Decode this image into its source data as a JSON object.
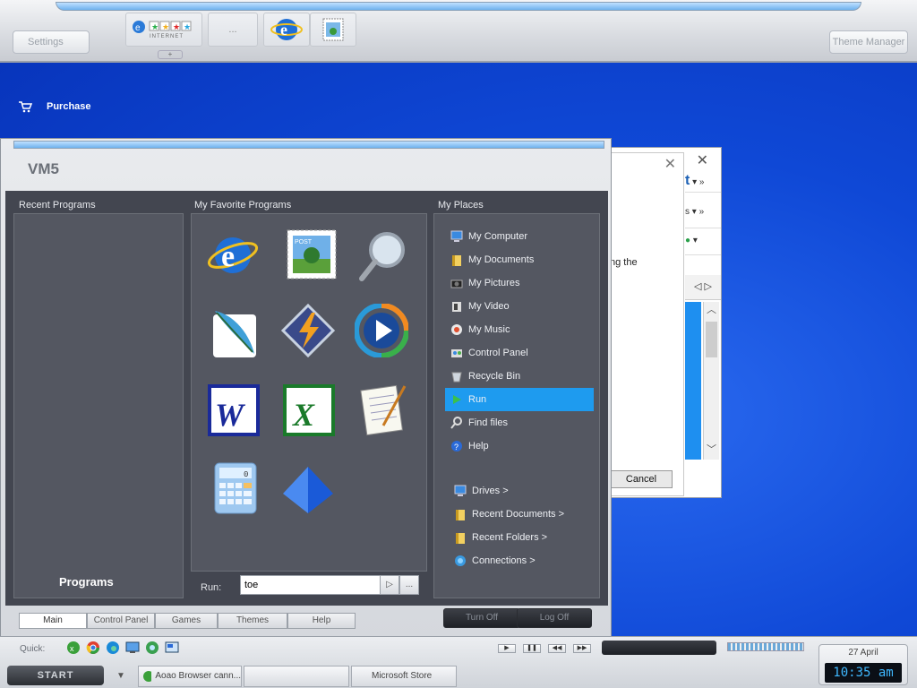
{
  "topbar": {
    "settings_label": "Settings",
    "theme_manager_label": "Theme Manager",
    "more_label": "...",
    "internet_label": "INTERNET",
    "expand_label": "+"
  },
  "desktop": {
    "purchase_label": "Purchase"
  },
  "background_window": {
    "text_fragment": "ng the",
    "cancel_label": "Cancel",
    "letter_s": "s"
  },
  "start_menu": {
    "title": "VM5",
    "recent_programs_head": "Recent Programs",
    "favorites_head": "My Favorite Programs",
    "places_head": "My Places",
    "programs_label": "Programs",
    "favorites": [
      {
        "icon": "internet-explorer-icon"
      },
      {
        "icon": "mail-stamp-icon"
      },
      {
        "icon": "magnifier-icon"
      },
      {
        "icon": "feather-icon"
      },
      {
        "icon": "winamp-icon"
      },
      {
        "icon": "media-player-icon"
      },
      {
        "icon": "word-icon"
      },
      {
        "icon": "excel-icon"
      },
      {
        "icon": "notepad-icon"
      },
      {
        "icon": "calculator-icon"
      },
      {
        "icon": "pyramid-icon"
      }
    ],
    "places": [
      {
        "label": "My Computer",
        "icon": "computer-icon"
      },
      {
        "label": "My Documents",
        "icon": "folder-icon"
      },
      {
        "label": "My Pictures",
        "icon": "camera-icon"
      },
      {
        "label": "My Video",
        "icon": "video-icon"
      },
      {
        "label": "My Music",
        "icon": "music-icon"
      },
      {
        "label": "Control Panel",
        "icon": "control-panel-icon"
      },
      {
        "label": "Recycle Bin",
        "icon": "recycle-bin-icon"
      },
      {
        "label": "Run",
        "icon": "run-icon"
      },
      {
        "label": "Find files",
        "icon": "search-icon"
      },
      {
        "label": "Help",
        "icon": "help-icon"
      }
    ],
    "submenus": [
      {
        "label": "Drives >",
        "icon": "drive-icon"
      },
      {
        "label": "Recent Documents >",
        "icon": "folder-icon"
      },
      {
        "label": "Recent Folders >",
        "icon": "folder-icon"
      },
      {
        "label": "Connections >",
        "icon": "network-icon"
      }
    ],
    "run_label": "Run:",
    "run_value": "toe",
    "run_go": "▷",
    "run_browse": "...",
    "tabs": [
      "Main",
      "Control Panel",
      "Games",
      "Themes",
      "Help"
    ],
    "turn_off_label": "Turn Off",
    "log_off_label": "Log Off"
  },
  "taskbar": {
    "quick_label": "Quick:",
    "start_label": "START",
    "tasks": [
      "Aoao Browser cann...",
      "",
      "Microsoft Store"
    ],
    "clock_date": "27 April",
    "clock_time": "10:35 am"
  },
  "colors": {
    "accent": "#1e9bef",
    "desktop": "#0a3fd0",
    "menu_dark": "#434650"
  }
}
